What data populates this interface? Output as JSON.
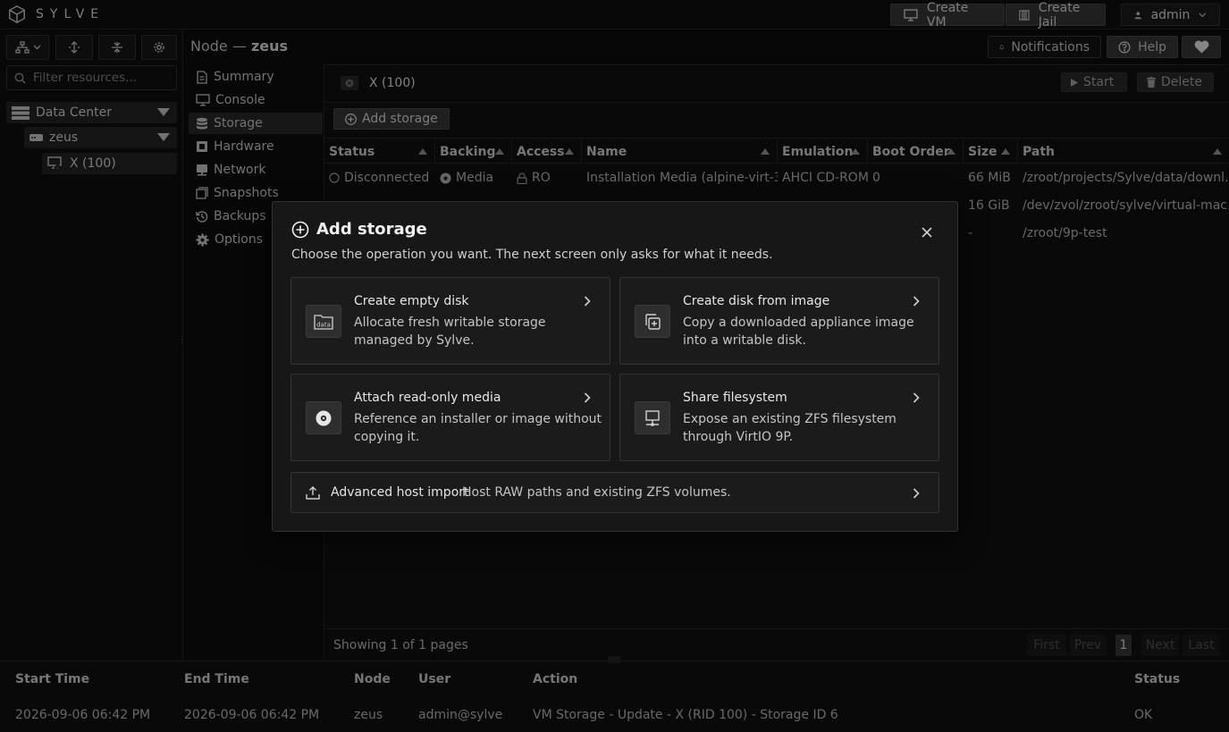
{
  "app": {
    "logo_text": "SYLVE"
  },
  "topbar": {
    "create_vm": "Create VM",
    "create_jail": "Create Jail",
    "user": "admin"
  },
  "left": {
    "filter_placeholder": "Filter resources...",
    "tree": {
      "datacenter": "Data Center",
      "node": "zeus",
      "vm": "X (100)"
    }
  },
  "node_header": {
    "prefix": "Node —",
    "name": "zeus"
  },
  "header_buttons": {
    "notifications": "Notifications",
    "help": "Help"
  },
  "nav": [
    {
      "label": "Summary",
      "icon": "file-icon"
    },
    {
      "label": "Console",
      "icon": "monitor-icon"
    },
    {
      "label": "Storage",
      "icon": "database-icon"
    },
    {
      "label": "Hardware",
      "icon": "hardware-icon"
    },
    {
      "label": "Network",
      "icon": "network-icon"
    },
    {
      "label": "Snapshots",
      "icon": "snapshot-icon"
    },
    {
      "label": "Backups",
      "icon": "backup-icon"
    },
    {
      "label": "Options",
      "icon": "gear-icon"
    }
  ],
  "vm": {
    "title": "X (100)",
    "start": "Start",
    "delete": "Delete",
    "add_storage": "Add storage"
  },
  "table": {
    "columns": [
      "Status",
      "Backing",
      "Access",
      "Name",
      "Emulation",
      "Boot Order",
      "Size",
      "Path"
    ],
    "rows": [
      {
        "status": "Disconnected",
        "backing": "Media",
        "access": "RO",
        "name": "Installation Media (alpine-virt-3…",
        "emulation": "AHCI CD-ROM",
        "boot_order": "0",
        "size": "66 MiB",
        "path": "/zroot/projects/Sylve/data/downl…"
      },
      {
        "status": "",
        "backing": "",
        "access": "",
        "name": "",
        "emulation": "",
        "boot_order": "",
        "size": "16 GiB",
        "path": "/dev/zvol/zroot/sylve/virtual-mac…"
      },
      {
        "status": "",
        "backing": "",
        "access": "",
        "name": "",
        "emulation": "",
        "boot_order": "",
        "size": "-",
        "path": "/zroot/9p-test"
      }
    ],
    "footer": "Showing 1 of 1 pages",
    "pagination": {
      "first": "First",
      "prev": "Prev",
      "page": "1",
      "next": "Next",
      "last": "Last"
    }
  },
  "log": {
    "columns": [
      "Start Time",
      "End Time",
      "Node",
      "User",
      "Action",
      "Status"
    ],
    "row": {
      "start": "2026-09-06 06:42 PM",
      "end": "2026-09-06 06:42 PM",
      "node": "zeus",
      "user": "admin@sylve",
      "action": "VM Storage - Update - X (RID 100) - Storage ID 6",
      "status": "OK"
    }
  },
  "modal": {
    "title": "Add storage",
    "subtitle": "Choose the operation you want. The next screen only asks for what it needs.",
    "cards": [
      {
        "title": "Create empty disk",
        "desc": "Allocate fresh writable storage managed by Sylve.",
        "icon": "folder-data-icon"
      },
      {
        "title": "Create disk from image",
        "desc": "Copy a downloaded appliance image into a writable disk.",
        "icon": "copy-plus-icon"
      },
      {
        "title": "Attach read-only media",
        "desc": "Reference an installer or image without copying it.",
        "icon": "disc-icon"
      },
      {
        "title": "Share filesystem",
        "desc": "Expose an existing ZFS filesystem through VirtIO 9P.",
        "icon": "share-monitor-icon"
      }
    ],
    "advanced": {
      "title": "Advanced host import",
      "desc": "Host RAW paths and existing ZFS volumes."
    }
  },
  "colors": {
    "background": "#0d0d0d",
    "panel": "#121212",
    "modal": "#171717",
    "accent_ok": "#22c55e"
  }
}
